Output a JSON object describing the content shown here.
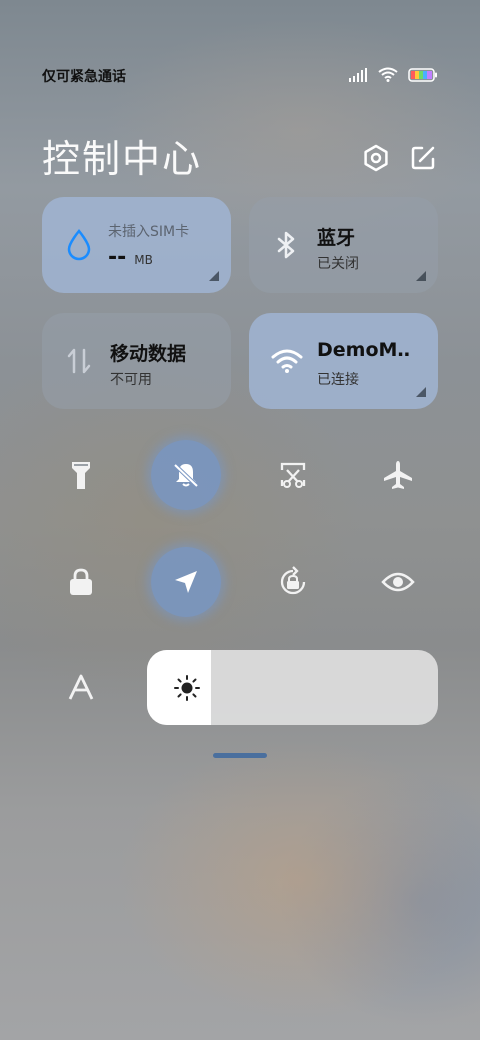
{
  "status_bar": {
    "carrier_text": "仅可紧急通话"
  },
  "header": {
    "title": "控制中心",
    "icons": [
      "settings-icon",
      "edit-icon"
    ]
  },
  "tiles": {
    "data_usage": {
      "subtitle": "未插入SIM卡",
      "value": "--",
      "unit": "MB",
      "icon": "water-drop-icon"
    },
    "bluetooth": {
      "title": "蓝牙",
      "status": "已关闭",
      "icon": "bluetooth-icon"
    },
    "mobile_data": {
      "title": "移动数据",
      "status": "不可用",
      "icon": "mobile-data-icon"
    },
    "wifi": {
      "title": "DemoM‥",
      "status": "已连接",
      "icon": "wifi-icon"
    }
  },
  "toggles": [
    {
      "name": "flashlight",
      "icon": "flashlight-icon",
      "active": false
    },
    {
      "name": "mute",
      "icon": "bell-off-icon",
      "active": true
    },
    {
      "name": "screenshot",
      "icon": "scissors-icon",
      "active": false
    },
    {
      "name": "airplane-mode",
      "icon": "airplane-icon",
      "active": false
    },
    {
      "name": "lock-screen",
      "icon": "lock-icon",
      "active": false
    },
    {
      "name": "location",
      "icon": "location-arrow-icon",
      "active": true
    },
    {
      "name": "auto-rotate",
      "icon": "rotate-lock-icon",
      "active": false
    },
    {
      "name": "reading-mode",
      "icon": "eye-icon",
      "active": false
    }
  ],
  "brightness": {
    "icon": "sun-icon",
    "level": 0.22,
    "auto_icon": "font-a-icon"
  },
  "colors": {
    "accent": "#1a8cff",
    "active_tile": "#a0b4d2",
    "handle": "#4a6f9e"
  }
}
